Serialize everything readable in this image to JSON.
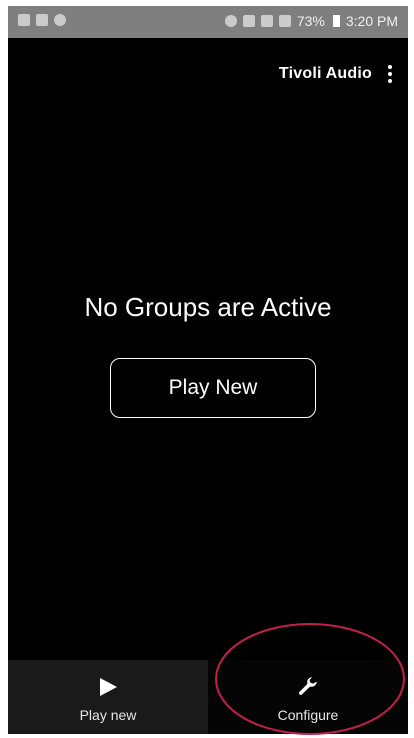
{
  "status_bar": {
    "battery": "73%",
    "time": "3:20 PM",
    "icons": [
      "gallery-icon",
      "notification-icon",
      "mute-icon",
      "bluetooth-icon",
      "wifi-icon",
      "signal-icon"
    ]
  },
  "app_bar": {
    "title": "Tivoli Audio",
    "overflow_icon": "more-vert-icon"
  },
  "main": {
    "empty_message": "No Groups are Active",
    "play_new_button": "Play New"
  },
  "bottom_nav": {
    "items": [
      {
        "label": "Play new",
        "icon": "play-icon"
      },
      {
        "label": "Configure",
        "icon": "wrench-icon"
      }
    ]
  },
  "annotation": {
    "color": "#c0204a",
    "target": "Configure"
  },
  "colors": {
    "background": "#000000",
    "text": "#ffffff",
    "status_bar": "#7f7f7f"
  }
}
